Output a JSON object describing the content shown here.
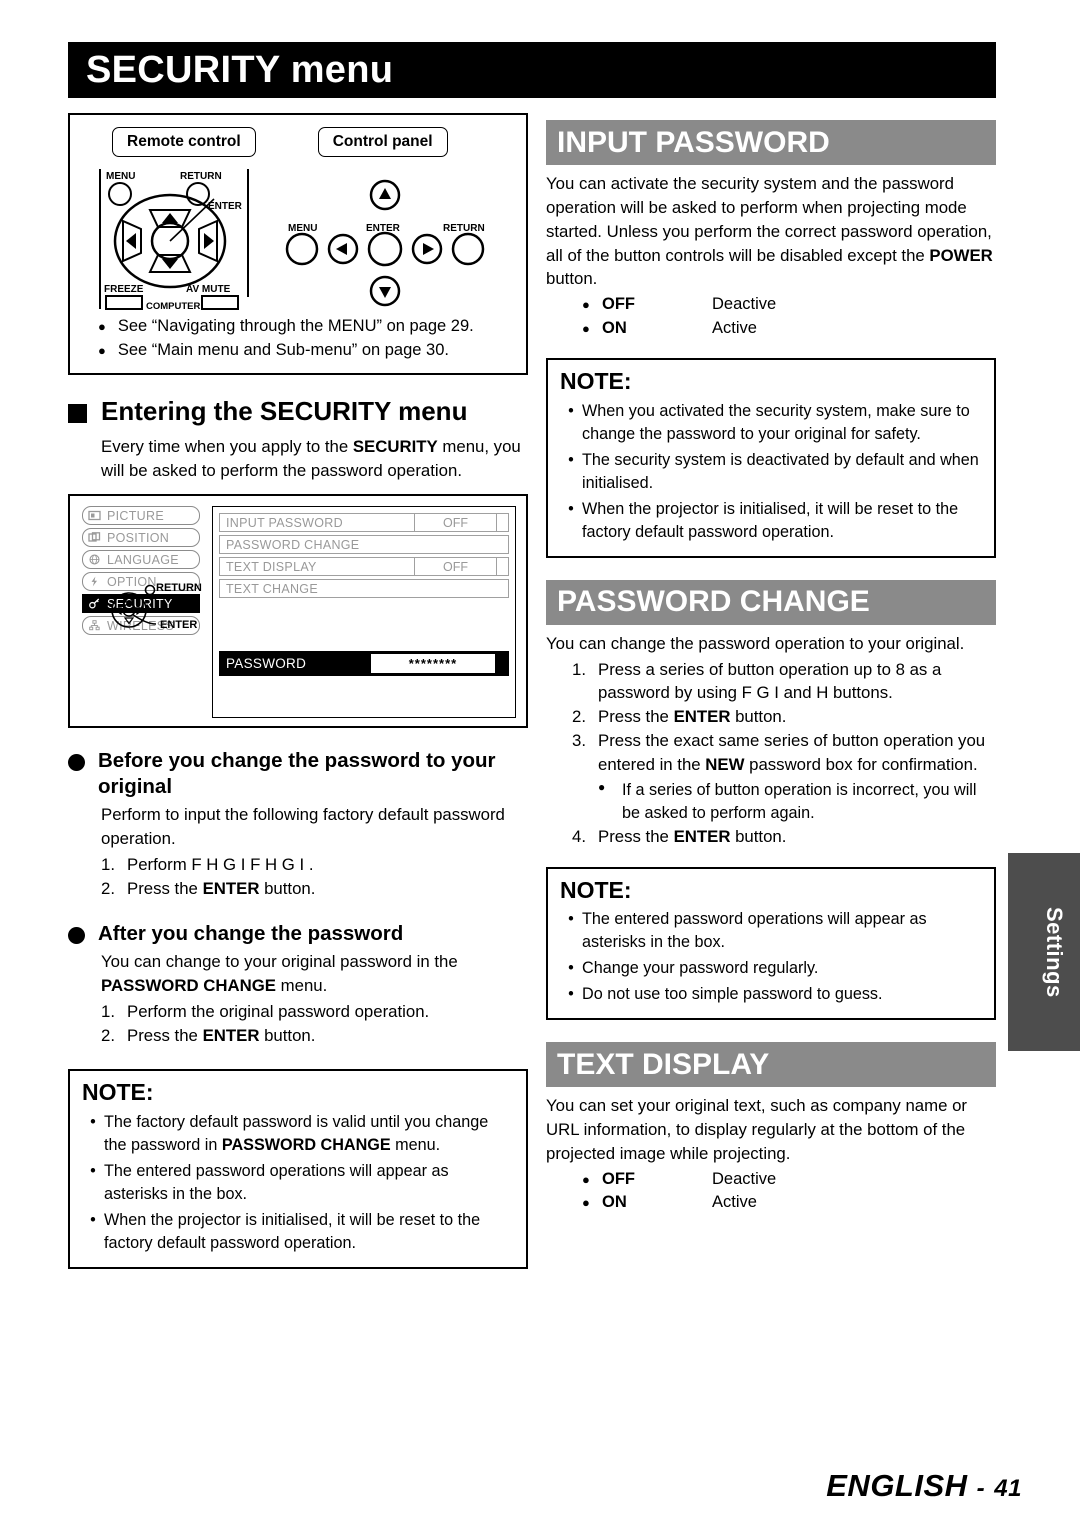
{
  "page": {
    "title": "SECURITY menu",
    "footer_language": "ENGLISH",
    "footer_separator": "-",
    "footer_page": "41",
    "side_tab": "Settings"
  },
  "diagram": {
    "remote_label": "Remote control",
    "panel_label": "Control panel",
    "remote": {
      "menu": "MENU",
      "return": "RETURN",
      "enter": "ENTER",
      "freeze": "FREEZE",
      "av_mute": "AV MUTE",
      "computer": "COMPUTER"
    },
    "panel": {
      "menu": "MENU",
      "enter": "ENTER",
      "return": "RETURN"
    },
    "bullets": [
      "See “Navigating through the MENU” on page 29.",
      "See “Main menu and Sub-menu” on page 30."
    ]
  },
  "entering": {
    "heading": "Entering the SECURITY menu",
    "paragraph_parts": [
      {
        "t": "Every time when you apply to the ",
        "b": false
      },
      {
        "t": "SECURITY",
        "b": true
      },
      {
        "t": " menu, you will be asked to perform the password operation.",
        "b": false
      }
    ]
  },
  "osd": {
    "menu_items": [
      {
        "label": "PICTURE",
        "icon": "picture-icon",
        "selected": false
      },
      {
        "label": "POSITION",
        "icon": "position-icon",
        "selected": false
      },
      {
        "label": "LANGUAGE",
        "icon": "globe-icon",
        "selected": false
      },
      {
        "label": "OPTION",
        "icon": "option-icon",
        "selected": false
      },
      {
        "label": "SECURITY",
        "icon": "key-icon",
        "selected": true
      },
      {
        "label": "WIRELESS",
        "icon": "network-icon",
        "selected": false
      }
    ],
    "rows": [
      {
        "label": "INPUT PASSWORD",
        "value": "OFF",
        "has_value": true
      },
      {
        "label": "PASSWORD CHANGE",
        "value": "",
        "has_value": false
      },
      {
        "label": "TEXT DISPLAY",
        "value": "OFF",
        "has_value": true
      },
      {
        "label": "TEXT CHANGE",
        "value": "",
        "has_value": false
      }
    ],
    "password_row": {
      "label": "PASSWORD",
      "value": "********"
    },
    "nav": {
      "return": "RETURN",
      "enter": "ENTER"
    }
  },
  "before_change": {
    "heading": "Before you change the password to your original",
    "paragraph": "Perform to input the following factory default password operation.",
    "steps": [
      {
        "n": "1.",
        "parts": [
          {
            "t": "Perform ",
            "b": false
          },
          {
            "t": "F  H  G  I   F  H  G  I",
            "b": false
          },
          {
            "t": " .",
            "b": false
          }
        ]
      },
      {
        "n": "2.",
        "parts": [
          {
            "t": "Press the ",
            "b": false
          },
          {
            "t": "ENTER",
            "b": true
          },
          {
            "t": " button.",
            "b": false
          }
        ]
      }
    ]
  },
  "after_change": {
    "heading": "After you change the password",
    "paragraph_parts": [
      {
        "t": "You can change to your original password in the ",
        "b": false
      },
      {
        "t": "PASSWORD CHANGE",
        "b": true
      },
      {
        "t": " menu.",
        "b": false
      }
    ],
    "steps": [
      {
        "n": "1.",
        "parts": [
          {
            "t": "Perform the original password operation.",
            "b": false
          }
        ]
      },
      {
        "n": "2.",
        "parts": [
          {
            "t": "Press the ",
            "b": false
          },
          {
            "t": "ENTER",
            "b": true
          },
          {
            "t": " button.",
            "b": false
          }
        ]
      }
    ]
  },
  "note_left": {
    "title": "NOTE:",
    "items": [
      [
        {
          "t": "The factory default password is valid until you change the password in ",
          "b": false
        },
        {
          "t": "PASSWORD CHANGE",
          "b": true
        },
        {
          "t": " menu.",
          "b": false
        }
      ],
      [
        {
          "t": "The entered password operations will appear as asterisks in the box.",
          "b": false
        }
      ],
      [
        {
          "t": "When the projector is initialised, it will be reset to the factory default password operation.",
          "b": false
        }
      ]
    ]
  },
  "input_password": {
    "heading": "INPUT PASSWORD",
    "paragraph_parts": [
      {
        "t": "You can activate the security system and the password operation will be asked to perform when projecting mode started. Unless you perform the correct password operation, all of the button controls will be disabled except the ",
        "b": false
      },
      {
        "t": "POWER",
        "b": true
      },
      {
        "t": " button.",
        "b": false
      }
    ],
    "options": [
      {
        "key": "OFF",
        "value": "Deactive"
      },
      {
        "key": "ON",
        "value": "Active"
      }
    ],
    "note": {
      "title": "NOTE:",
      "items": [
        [
          {
            "t": "When you activated the security system, make sure to change the password to your original for safety.",
            "b": false
          }
        ],
        [
          {
            "t": "The security system is deactivated by default and when initialised.",
            "b": false
          }
        ],
        [
          {
            "t": "When the projector is initialised, it will be reset to the factory default password operation.",
            "b": false
          }
        ]
      ]
    }
  },
  "password_change": {
    "heading": "PASSWORD CHANGE",
    "paragraph": "You can change the password operation to your original.",
    "steps": [
      {
        "n": "1.",
        "parts": [
          {
            "t": "Press a series of button operation up to 8 as a password by using F  G  I   and H  buttons.",
            "b": false
          }
        ]
      },
      {
        "n": "2.",
        "parts": [
          {
            "t": "Press the ",
            "b": false
          },
          {
            "t": "ENTER",
            "b": true
          },
          {
            "t": " button.",
            "b": false
          }
        ]
      },
      {
        "n": "3.",
        "parts": [
          {
            "t": "Press the exact same series of button operation you entered in the ",
            "b": false
          },
          {
            "t": "NEW",
            "b": true
          },
          {
            "t": " password box for confirmation.",
            "b": false
          }
        ]
      }
    ],
    "sub_bullet": "If a series of button operation is incorrect, you will be asked to perform again.",
    "step4": {
      "n": "4.",
      "parts": [
        {
          "t": "Press the ",
          "b": false
        },
        {
          "t": "ENTER",
          "b": true
        },
        {
          "t": " button.",
          "b": false
        }
      ]
    },
    "note": {
      "title": "NOTE:",
      "items": [
        [
          {
            "t": "The entered password operations will appear as asterisks in the box.",
            "b": false
          }
        ],
        [
          {
            "t": "Change your password regularly.",
            "b": false
          }
        ],
        [
          {
            "t": "Do not use too simple password to guess.",
            "b": false
          }
        ]
      ]
    }
  },
  "text_display": {
    "heading": "TEXT DISPLAY",
    "paragraph": "You can set your original text, such as company name or URL information, to display regularly at the bottom of the projected image while projecting.",
    "options": [
      {
        "key": "OFF",
        "value": "Deactive"
      },
      {
        "key": "ON",
        "value": "Active"
      }
    ]
  }
}
